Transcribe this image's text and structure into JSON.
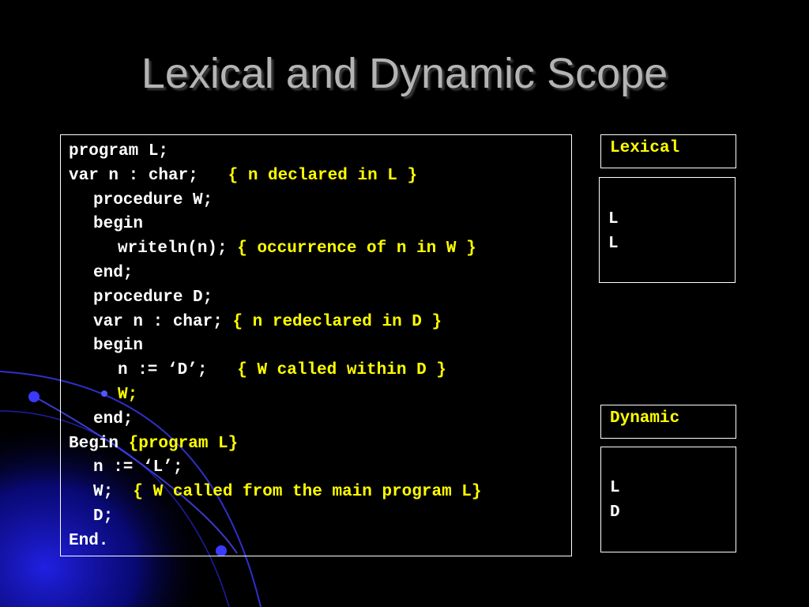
{
  "slide": {
    "title": "Lexical and Dynamic Scope"
  },
  "code": {
    "lines": [
      {
        "code": "program L;",
        "comment": ""
      },
      {
        "code": "var n : char;   ",
        "comment": "{ n declared in L }"
      },
      {
        "code": "procedure W;",
        "comment": ""
      },
      {
        "code": "begin",
        "comment": ""
      },
      {
        "code": "writeln(n); ",
        "comment": "{ occurrence of n in W }"
      },
      {
        "code": "end;",
        "comment": ""
      },
      {
        "code": "procedure D;",
        "comment": ""
      },
      {
        "code": "var n : char; ",
        "comment": "{ n redeclared in D }"
      },
      {
        "code": "begin",
        "comment": ""
      },
      {
        "code": "n := ‘D’;   ",
        "comment": "{ W called within D }"
      },
      {
        "code": "",
        "comment": "W;"
      },
      {
        "code": "end;",
        "comment": ""
      },
      {
        "code": "Begin ",
        "comment": "{program L}"
      },
      {
        "code": "n := ‘L’;",
        "comment": ""
      },
      {
        "code": "W;  ",
        "comment": "{ W called from the main program L}"
      },
      {
        "code": "D;",
        "comment": ""
      },
      {
        "code": "End.",
        "comment": ""
      }
    ]
  },
  "lexical": {
    "label": "Lexical",
    "results": [
      "L",
      "L"
    ]
  },
  "dynamic": {
    "label": "Dynamic",
    "results": [
      "L",
      "D"
    ]
  },
  "colors": {
    "background": "#000000",
    "title": "#b4b4b4",
    "code": "#ffffff",
    "comment": "#ffff00",
    "swoosh": "#1a1adc"
  }
}
